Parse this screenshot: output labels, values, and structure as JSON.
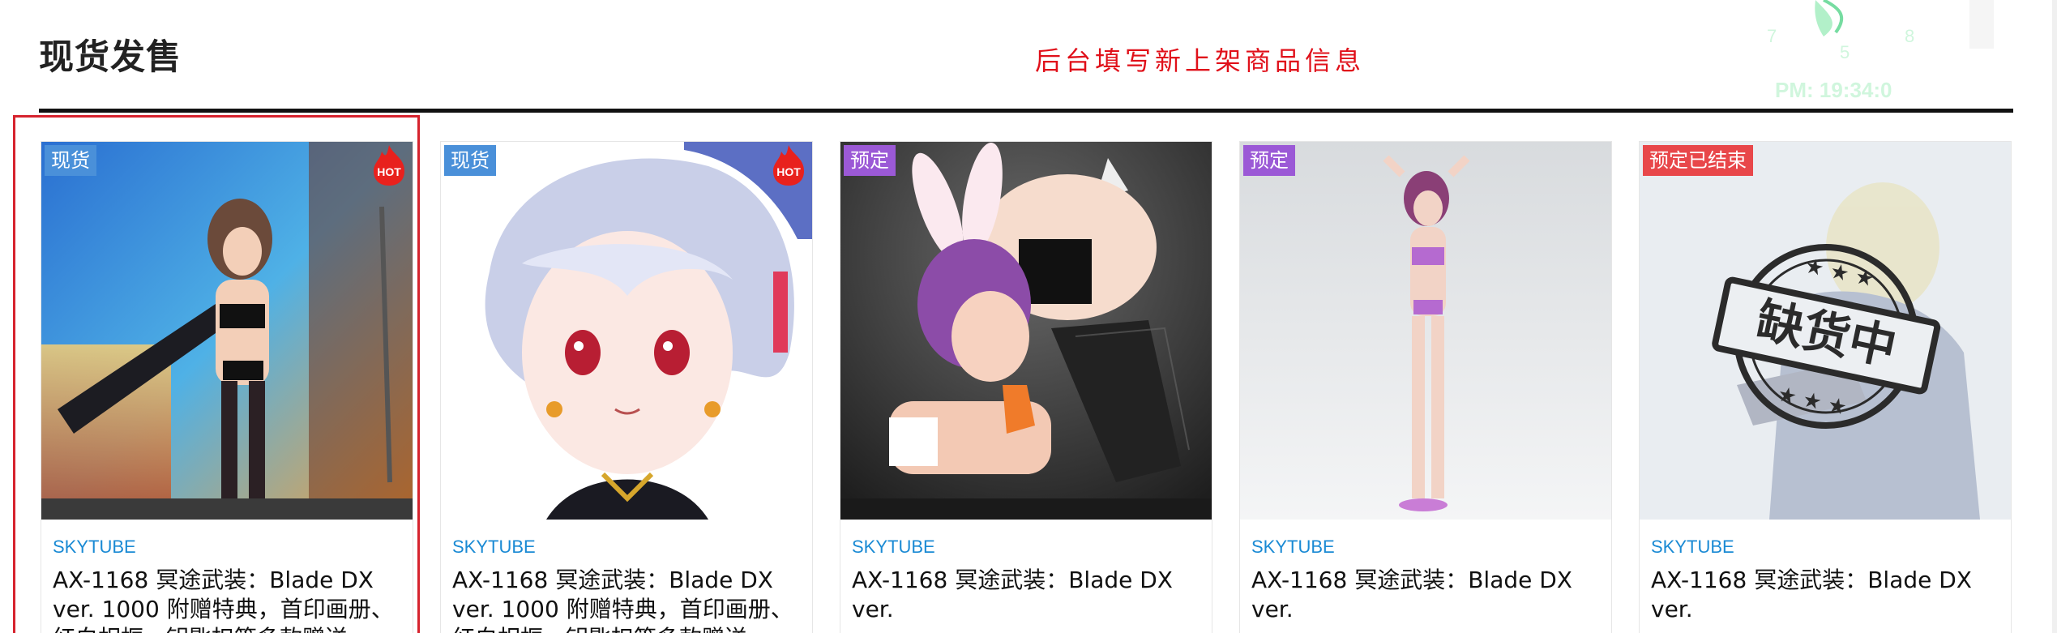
{
  "section": {
    "title": "现货发售"
  },
  "admin_note": "后台填写新上架商品信息",
  "clock": {
    "time_text": "PM: 19:34:0",
    "numerals": [
      "7",
      "5",
      "8"
    ]
  },
  "colors": {
    "badge_instock": "#4a90d9",
    "badge_preorder": "#9b59d6",
    "badge_ended": "#e8474a",
    "brand": "#1a8ad4",
    "highlight": "#d6232e",
    "admin_note": "#e0101a"
  },
  "products": [
    {
      "status": "现货",
      "hot": true,
      "hot_label": "HOT",
      "brand": "SKYTUBE",
      "name": "AX-1168 冥途武装：Blade DX ver. 1000 附赠特典，首印画册、红白相框，钥匙扣等多款赠送"
    },
    {
      "status": "现货",
      "hot": true,
      "hot_label": "HOT",
      "brand": "SKYTUBE",
      "name": "AX-1168 冥途武装：Blade DX ver. 1000 附赠特典，首印画册、红白相框，钥匙扣等多款赠送"
    },
    {
      "status": "预定",
      "hot": false,
      "brand": "SKYTUBE",
      "name": "AX-1168 冥途武装：Blade DX ver."
    },
    {
      "status": "预定",
      "hot": false,
      "brand": "SKYTUBE",
      "name": "AX-1168 冥途武装：Blade DX ver."
    },
    {
      "status": "预定已结束",
      "hot": false,
      "brand": "SKYTUBE",
      "name": "AX-1168 冥途武装：Blade DX ver.",
      "stamp_text": "缺货中"
    }
  ]
}
